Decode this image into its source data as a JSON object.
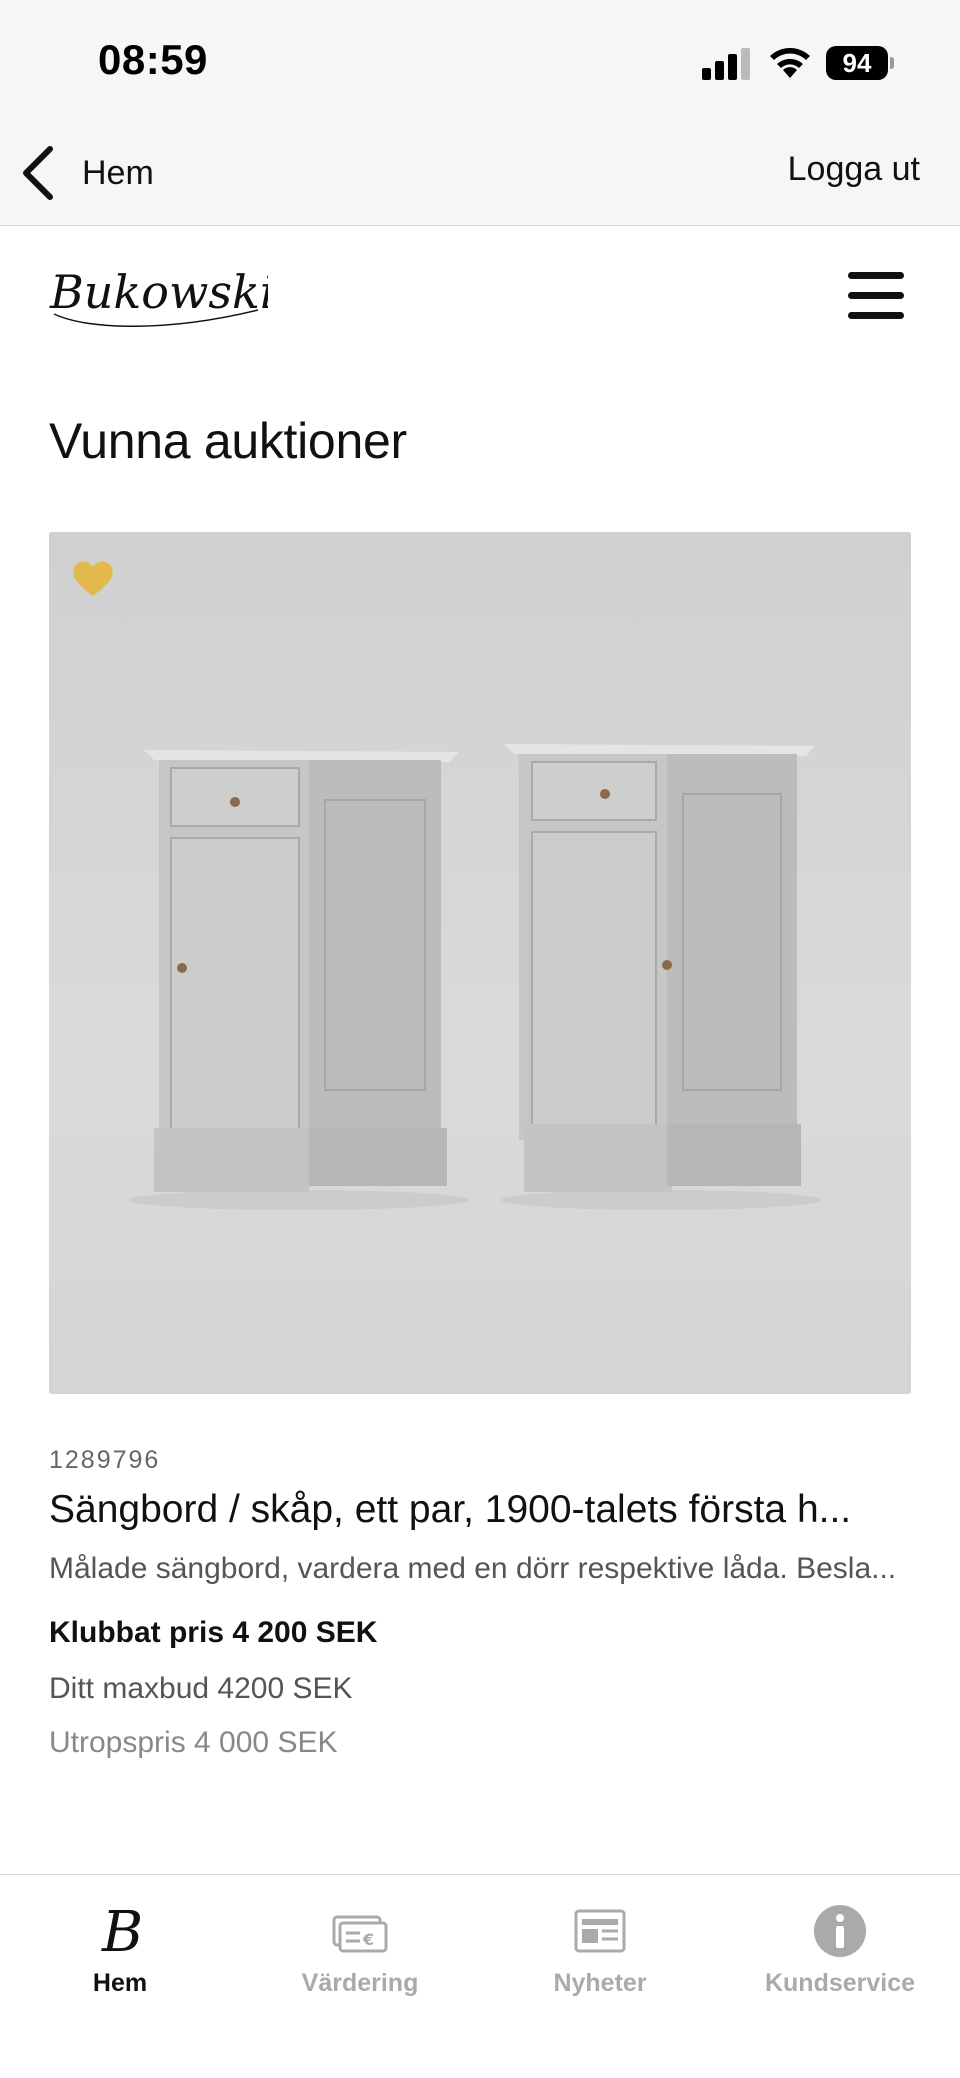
{
  "status_bar": {
    "time": "08:59",
    "battery": "94"
  },
  "nav": {
    "back_label": "Hem",
    "logout_label": "Logga ut"
  },
  "header": {
    "logo_text": "Bukowskis"
  },
  "page": {
    "title": "Vunna auktioner"
  },
  "lot": {
    "number": "1289796",
    "title": "Sängbord / skåp, ett par, 1900-talets första h...",
    "description": "Målade sängbord, vardera med en dörr respektive låda. Besla...",
    "hammer_price": "Klubbat pris 4 200 SEK",
    "max_bid": "Ditt maxbud 4200 SEK",
    "estimate": "Utropspris 4 000 SEK",
    "favorited": true
  },
  "tabs": [
    {
      "label": "Hem",
      "icon": "home-logo-icon",
      "active": true
    },
    {
      "label": "Värdering",
      "icon": "valuation-icon",
      "active": false
    },
    {
      "label": "Nyheter",
      "icon": "news-icon",
      "active": false
    },
    {
      "label": "Kundservice",
      "icon": "info-icon",
      "active": false
    }
  ],
  "colors": {
    "favorite": "#e2b94a",
    "inactive_tab": "#aaaaaa",
    "bar_background": "#f6f6f6"
  }
}
